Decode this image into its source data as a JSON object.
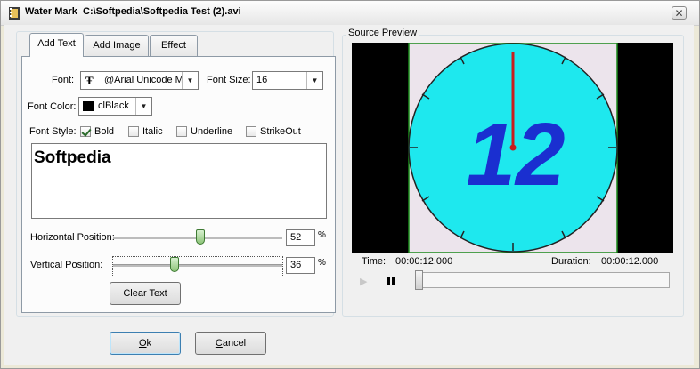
{
  "window": {
    "title": "Water Mark  C:\\Softpedia\\Softpedia Test (2).avi",
    "close_glyph": "✕"
  },
  "tabs": [
    {
      "label": "Add Text",
      "active": true
    },
    {
      "label": "Add Image",
      "active": false
    },
    {
      "label": "Effect",
      "active": false
    }
  ],
  "text_tab": {
    "font_label": "Font:",
    "font_value": "@Arial Unicode MS",
    "font_icon": "truetype-font-icon",
    "font_size_label": "Font Size:",
    "font_size_value": "16",
    "font_color_label": "Font Color:",
    "font_color_value": "clBlack",
    "font_color_swatch": "#000000",
    "font_style_label": "Font Style:",
    "styles": [
      {
        "label": "Bold",
        "checked": true
      },
      {
        "label": "Italic",
        "checked": false
      },
      {
        "label": "Underline",
        "checked": false
      },
      {
        "label": "StrikeOut",
        "checked": false
      }
    ],
    "text_value": "Softpedia",
    "horizontal_label": "Horizontal Position:",
    "horizontal_value": "52",
    "vertical_label": "Vertical Position:",
    "vertical_value": "36",
    "percent": "%",
    "clear_button": "Clear Text"
  },
  "buttons": {
    "ok_mnemonic": "O",
    "ok_rest": "k",
    "cancel_mnemonic": "C",
    "cancel_rest": "ancel"
  },
  "preview": {
    "group_title": "Source Preview",
    "time_label": "Time:",
    "time_value": "00:00:12.000",
    "duration_label": "Duration:",
    "duration_value": "00:00:12.000",
    "clock_text": "12",
    "clock_color": "#1ee8ee",
    "clock_digit_color": "#1a2fd0",
    "hand_color": "#c81e1e",
    "play_glyph": "▶",
    "seek_position": 0
  }
}
